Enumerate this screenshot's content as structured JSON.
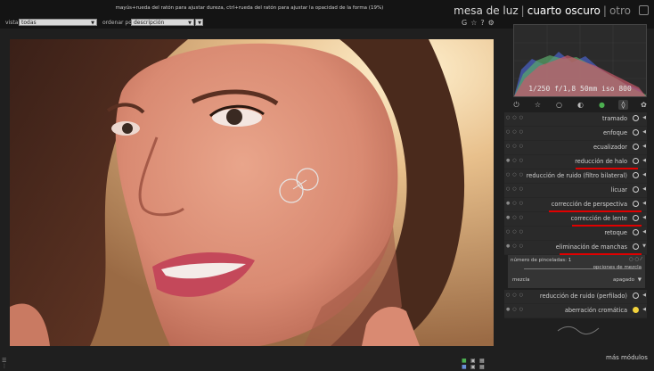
{
  "header": {
    "hint": "mayús+rueda del ratón para ajustar dureza, ctrl+rueda del ratón para ajustar la opacidad de la forma (19%)",
    "views": [
      {
        "label": "mesa de luz",
        "state": "normal"
      },
      {
        "label": "cuarto oscuro",
        "state": "active"
      },
      {
        "label": "otro",
        "state": "dim"
      }
    ],
    "separator": "|"
  },
  "filter": {
    "view_label": "vista",
    "view_value": "todas",
    "sort_label": "ordenar por",
    "sort_value": "descripción",
    "arrow": "▼"
  },
  "top_icons": {
    "grouping": "G",
    "star": "☆",
    "help": "?",
    "prefs": "⚙"
  },
  "histogram": {
    "exif": "1/250 f/1,8 50mm iso 800"
  },
  "module_groups": [
    {
      "icon": "power-icon",
      "glyph": "⏻"
    },
    {
      "icon": "star-icon",
      "glyph": "☆"
    },
    {
      "icon": "circle-icon",
      "glyph": "○"
    },
    {
      "icon": "half-circle-icon",
      "glyph": "◐"
    },
    {
      "icon": "color-icon",
      "glyph": "●"
    },
    {
      "icon": "effect-icon",
      "glyph": "◊"
    },
    {
      "icon": "settings-icon",
      "glyph": "✿"
    }
  ],
  "modules": [
    {
      "name": "tramado",
      "highlight": false
    },
    {
      "name": "enfoque",
      "highlight": false
    },
    {
      "name": "ecualizador",
      "highlight": false
    },
    {
      "name": "reducción de halo",
      "highlight": true
    },
    {
      "name": "reducción de ruido (filtro bilateral)",
      "highlight": false
    },
    {
      "name": "licuar",
      "highlight": false
    },
    {
      "name": "corrección de perspectiva",
      "highlight": true
    },
    {
      "name": "corrección de lente",
      "highlight": true
    },
    {
      "name": "retoque",
      "highlight": false
    },
    {
      "name": "eliminación de manchas",
      "highlight": true
    }
  ],
  "spot_panel": {
    "strokes_label": "número de pinceladas: 1",
    "blend_options": "opciones de mezcla",
    "blend_label": "mezcla",
    "blend_value": "apagado",
    "arrow": "▼"
  },
  "modules_after": [
    {
      "name": "reducción de ruido (perfilado)",
      "highlight": false
    },
    {
      "name": "aberración cromática",
      "highlight": true
    }
  ],
  "more_modules": "más módulos",
  "accent_color": "#e00000"
}
